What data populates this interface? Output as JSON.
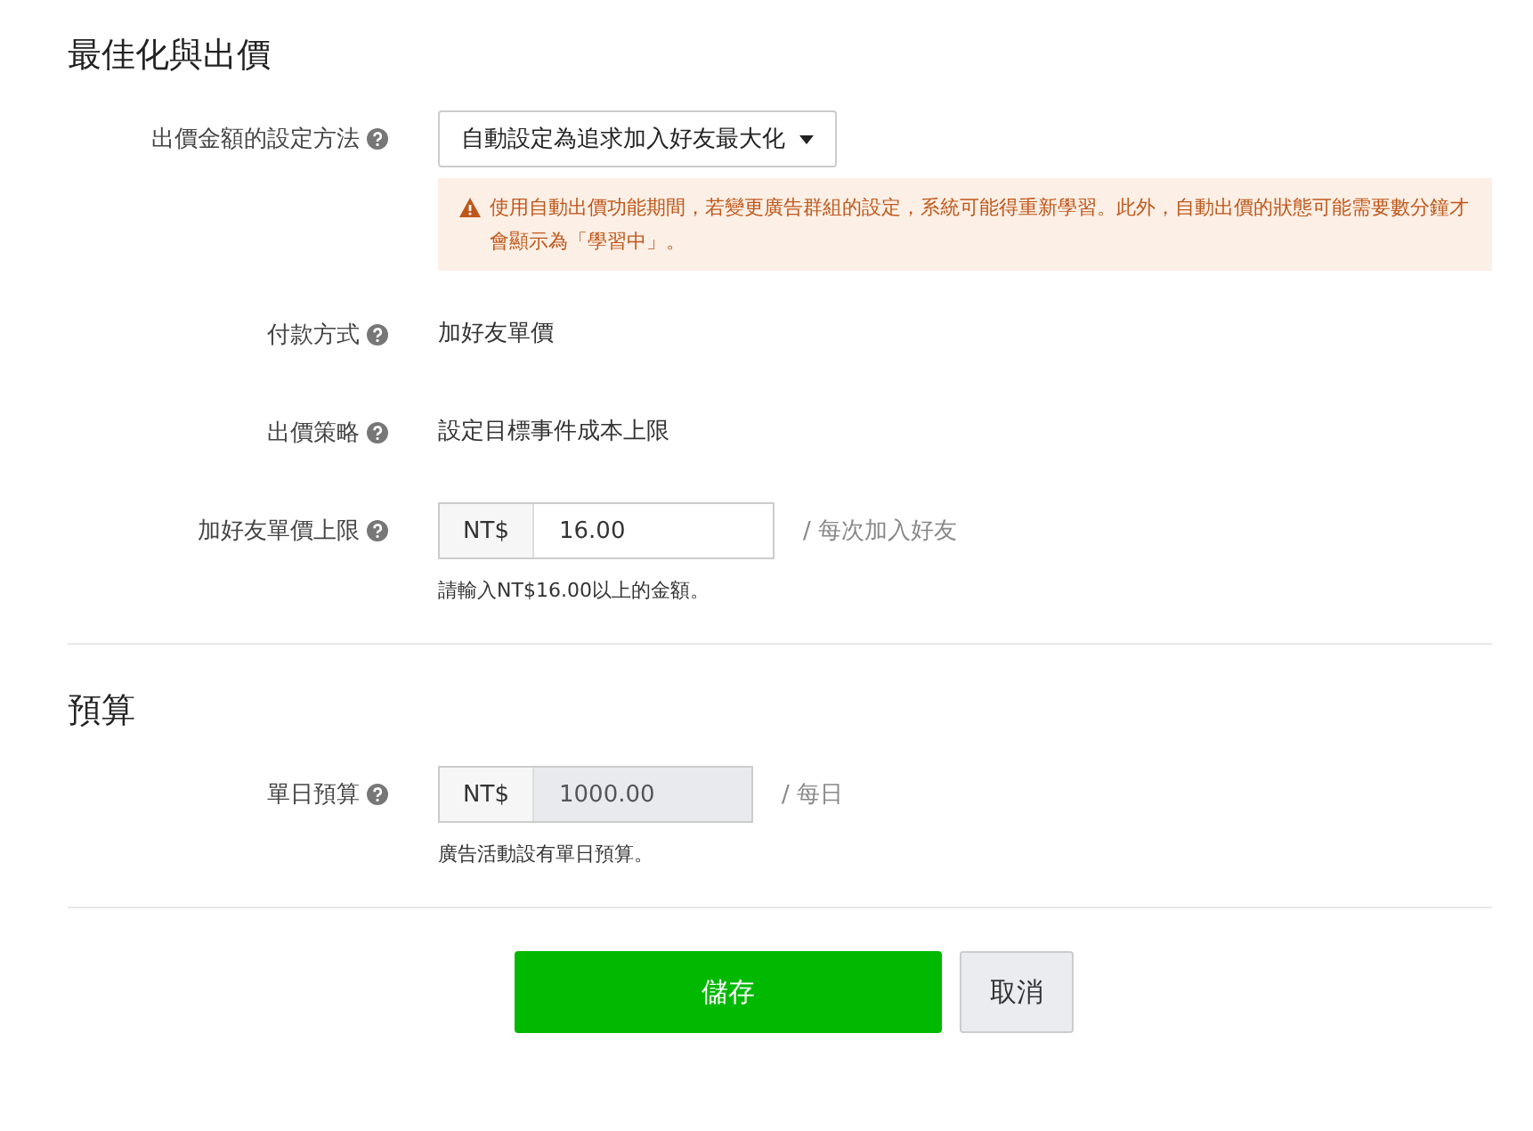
{
  "sections": [
    {
      "title": "最佳化與出價",
      "rows": [
        {
          "kind": "select",
          "label": "出價金額的設定方法",
          "value": "自動設定為追求加入好友最大化",
          "warning": "使用自動出價功能期間，若變更廣告群組的設定，系統可能得重新學習。此外，自動出價的狀態可能需要數分鐘才會顯示為「學習中」。"
        },
        {
          "kind": "text",
          "label": "付款方式",
          "value": "加好友單價"
        },
        {
          "kind": "text",
          "label": "出價策略",
          "value": "設定目標事件成本上限"
        },
        {
          "kind": "money",
          "label": "加好友單價上限",
          "currency": "NT$",
          "value": "16.00",
          "disabled": false,
          "unit": "/ 每次加入好友",
          "hint": "請輸入NT$16.00以上的金額。"
        }
      ]
    },
    {
      "title": "預算",
      "rows": [
        {
          "kind": "money",
          "label": "單日預算",
          "currency": "NT$",
          "value": "1000.00",
          "disabled": true,
          "unit": "/ 每日",
          "hint": "廣告活動設有單日預算。"
        }
      ]
    }
  ],
  "buttons": [
    {
      "label": "儲存",
      "kind": "primary"
    },
    {
      "label": "取消",
      "kind": "secondary"
    }
  ]
}
